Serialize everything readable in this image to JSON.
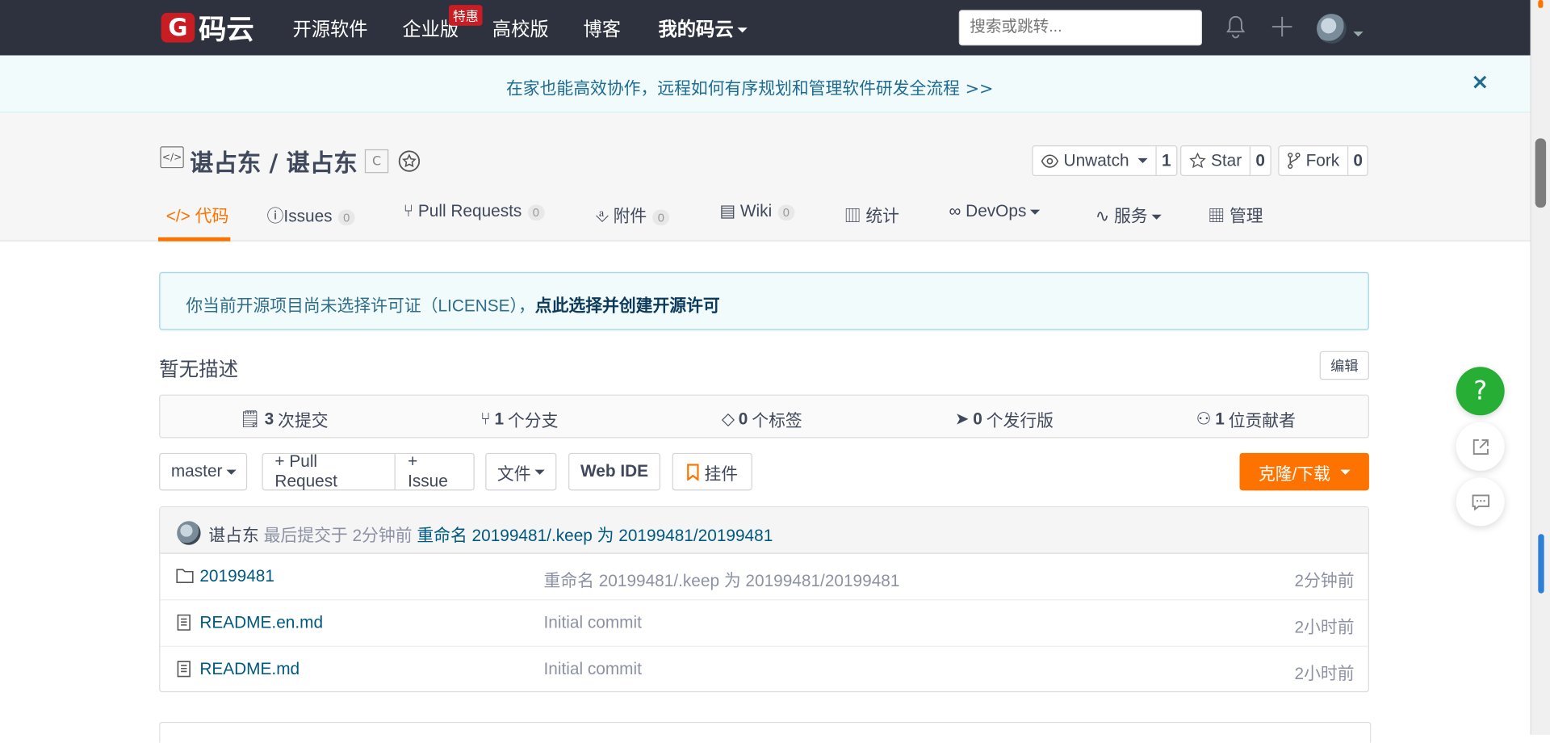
{
  "nav": {
    "logo_text": "码云",
    "items": [
      "开源软件",
      "企业版",
      "高校版",
      "博客",
      "我的码云"
    ],
    "enterprise_badge": "特惠",
    "search_placeholder": "搜索或跳转..."
  },
  "banner": {
    "text": "在家也能高效协作，远程如何有序规划和管理软件研发全流程 >>",
    "close": "×"
  },
  "repo": {
    "title": "谌占东 / 谌占东",
    "lang_tag": "C",
    "watch": {
      "label": "Unwatch",
      "count": "1"
    },
    "star": {
      "label": "Star",
      "count": "0"
    },
    "fork": {
      "label": "Fork",
      "count": "0"
    }
  },
  "tabs": [
    {
      "label": "代码",
      "count": ""
    },
    {
      "label": "Issues",
      "count": "0"
    },
    {
      "label": "Pull Requests",
      "count": "0"
    },
    {
      "label": "附件",
      "count": "0"
    },
    {
      "label": "Wiki",
      "count": "0"
    },
    {
      "label": "统计",
      "count": ""
    },
    {
      "label": "DevOps",
      "count": ""
    },
    {
      "label": "服务",
      "count": ""
    },
    {
      "label": "管理",
      "count": ""
    }
  ],
  "license_notice": {
    "text": "你当前开源项目尚未选择许可证（LICENSE），",
    "link": "点此选择并创建开源许可"
  },
  "description": "暂无描述",
  "edit_label": "编辑",
  "stats": [
    {
      "num": "3",
      "label": "次提交"
    },
    {
      "num": "1",
      "label": "个分支"
    },
    {
      "num": "0",
      "label": "个标签"
    },
    {
      "num": "0",
      "label": "个发行版"
    },
    {
      "num": "1",
      "label": "位贡献者"
    }
  ],
  "controls": {
    "branch": "master",
    "pull_request": "+ Pull Request",
    "issue": "+ Issue",
    "files": "文件",
    "web_ide": "Web IDE",
    "widget": "挂件",
    "clone": "克隆/下载"
  },
  "last_commit": {
    "author": "谌占东",
    "meta": "最后提交于 2分钟前",
    "message": "重命名 20199481/.keep 为 20199481/20199481"
  },
  "files": [
    {
      "type": "folder-icon",
      "name": "20199481",
      "message": "重命名 20199481/.keep 为 20199481/20199481",
      "time": "2分钟前"
    },
    {
      "type": "file-icon",
      "name": "README.en.md",
      "message": "Initial commit",
      "time": "2小时前"
    },
    {
      "type": "file-icon",
      "name": "README.md",
      "message": "Initial commit",
      "time": "2小时前"
    }
  ],
  "floating": {
    "help": "?"
  },
  "colors": {
    "accent": "#fe7300",
    "nav_bg": "#2e323e",
    "brand_red": "#c71d23",
    "help_green": "#27ae35",
    "link": "#005980"
  }
}
